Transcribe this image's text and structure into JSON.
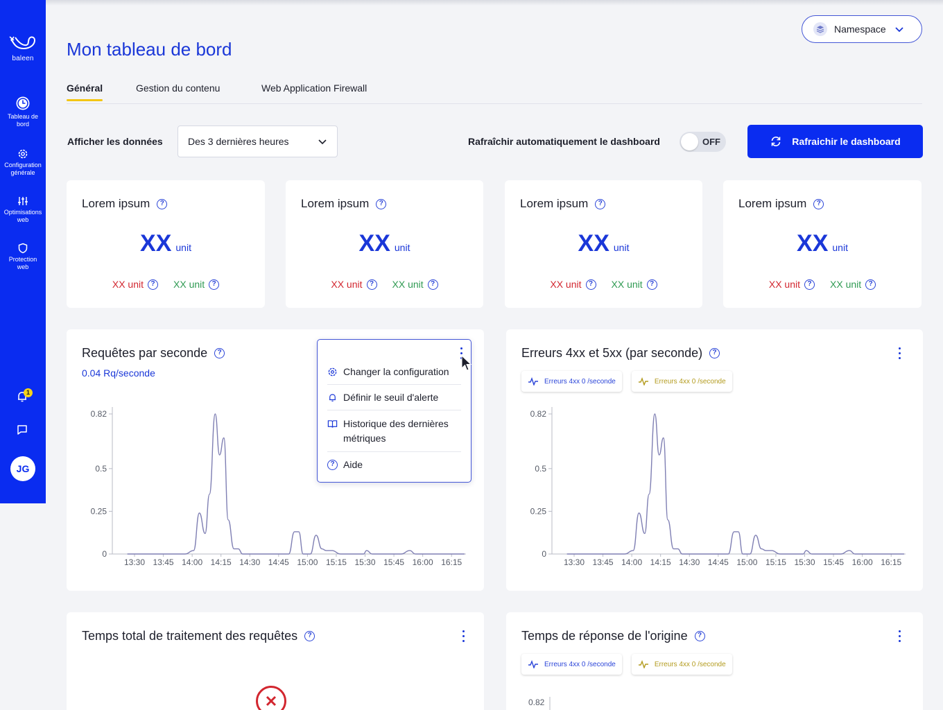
{
  "brand": {
    "name": "baleen"
  },
  "sidebar": {
    "items": [
      {
        "label_l1": "Tableau de",
        "label_l2": "bord"
      },
      {
        "label_l1": "Configuration",
        "label_l2": "générale"
      },
      {
        "label_l1": "Optimisations",
        "label_l2": "web"
      },
      {
        "label_l1": "Protection",
        "label_l2": "web"
      }
    ],
    "notifications_count": "1",
    "user_initials": "JG"
  },
  "header": {
    "title": "Mon tableau de bord",
    "namespace_label": "Namespace"
  },
  "tabs": [
    {
      "label": "Général"
    },
    {
      "label": "Gestion du contenu"
    },
    {
      "label": "Web Application Firewall"
    }
  ],
  "controls": {
    "show_data_label": "Afficher les données",
    "range_value": "Des 3 dernières heures",
    "auto_refresh_label": "Rafraîchir automatiquement le dashboard",
    "toggle_state": "OFF",
    "refresh_button": "Rafraichir le dashboard"
  },
  "kpis": [
    {
      "title": "Lorem ipsum",
      "value": "XX",
      "unit": "unit",
      "sub_red": "XX unit",
      "sub_green": "XX unit"
    },
    {
      "title": "Lorem ipsum",
      "value": "XX",
      "unit": "unit",
      "sub_red": "XX unit",
      "sub_green": "XX unit"
    },
    {
      "title": "Lorem ipsum",
      "value": "XX",
      "unit": "unit",
      "sub_red": "XX unit",
      "sub_green": "XX unit"
    },
    {
      "title": "Lorem ipsum",
      "value": "XX",
      "unit": "unit",
      "sub_red": "XX unit",
      "sub_green": "XX unit"
    }
  ],
  "panels": {
    "requests": {
      "title": "Requêtes par seconde",
      "subtitle": "0.04 Rq/seconde"
    },
    "errors": {
      "title": "Erreurs 4xx et 5xx (par seconde)"
    },
    "total_time": {
      "title": "Temps total de traitement des requêtes"
    },
    "origin": {
      "title": "Temps de réponse de l'origine"
    }
  },
  "legend": [
    {
      "label": "Erreurs 4xx 0 /seconde",
      "color": "#2a44d8"
    },
    {
      "label": "Erreurs 4xx 0 /seconde",
      "color": "#b39b1e"
    }
  ],
  "menu": {
    "items": [
      {
        "label": "Changer la configuration"
      },
      {
        "label": "Définir le seuil d'alerte"
      },
      {
        "label_l1": "Historique des dernières",
        "label_l2": "métriques"
      },
      {
        "label": "Aide"
      }
    ]
  },
  "colors": {
    "primary": "#0a2cf0",
    "title_blue": "#1a37d8",
    "line": "#7f7fb3",
    "red": "#d2262f",
    "green": "#2f9a52",
    "tab_underline": "#f3c614"
  },
  "chart_data": [
    {
      "type": "line",
      "yticks": [
        "0",
        "0.25",
        "0.5",
        "0.82"
      ],
      "ytick_values": [
        0,
        0.25,
        0.5,
        0.82
      ],
      "ylim": [
        0,
        0.82
      ],
      "xticks": [
        "13:30",
        "13:45",
        "14:00",
        "14:15",
        "14:30",
        "14:45",
        "15:00",
        "15:15",
        "15:30",
        "15:45",
        "16:00",
        "16:15"
      ],
      "x": [
        0,
        2,
        2.3,
        2.5,
        2.7,
        2.85,
        3.05,
        3.2,
        3.35,
        3.5,
        3.7,
        3.85,
        4.0,
        4.25,
        4.6,
        5.0,
        5.6,
        5.8,
        5.95,
        6.1,
        6.35,
        6.55,
        6.75,
        6.9,
        7.1,
        7.4,
        7.8,
        8.2,
        8.3,
        8.5,
        9.5,
        9.8,
        10.0,
        10.3,
        11.0,
        11.7
      ],
      "values": [
        0,
        0,
        0.02,
        0.24,
        0.12,
        0.35,
        0.82,
        0.58,
        0.68,
        0.2,
        0.03,
        0.03,
        0,
        0,
        0,
        0,
        0,
        0.13,
        0.13,
        0,
        0,
        0.11,
        0.03,
        0.02,
        0.02,
        0,
        0,
        0,
        0.02,
        0,
        0,
        0.02,
        0,
        0,
        0,
        0
      ]
    },
    {
      "type": "line",
      "yticks": [
        "0",
        "0.25",
        "0.5",
        "0.82"
      ],
      "ytick_values": [
        0,
        0.25,
        0.5,
        0.82
      ],
      "ylim": [
        0,
        0.82
      ],
      "xticks": [
        "13:30",
        "13:45",
        "14:00",
        "14:15",
        "14:30",
        "14:45",
        "15:00",
        "15:15",
        "15:30",
        "15:45",
        "16:00",
        "16:15"
      ],
      "x": [
        0,
        2,
        2.3,
        2.5,
        2.7,
        2.85,
        3.05,
        3.2,
        3.35,
        3.5,
        3.7,
        3.85,
        4.0,
        4.25,
        4.6,
        5.0,
        5.6,
        5.8,
        5.95,
        6.1,
        6.35,
        6.55,
        6.75,
        6.9,
        7.1,
        7.4,
        7.8,
        8.2,
        8.3,
        8.5,
        9.5,
        9.8,
        10.0,
        10.3,
        11.0,
        11.7
      ],
      "values": [
        0,
        0,
        0.02,
        0.24,
        0.12,
        0.35,
        0.82,
        0.58,
        0.68,
        0.2,
        0.03,
        0.03,
        0,
        0,
        0,
        0,
        0,
        0.13,
        0.13,
        0,
        0,
        0.11,
        0.03,
        0.02,
        0.02,
        0,
        0,
        0,
        0.02,
        0,
        0,
        0.02,
        0,
        0,
        0,
        0
      ]
    },
    {
      "type": "line",
      "yticks": [
        "0.82"
      ]
    }
  ]
}
